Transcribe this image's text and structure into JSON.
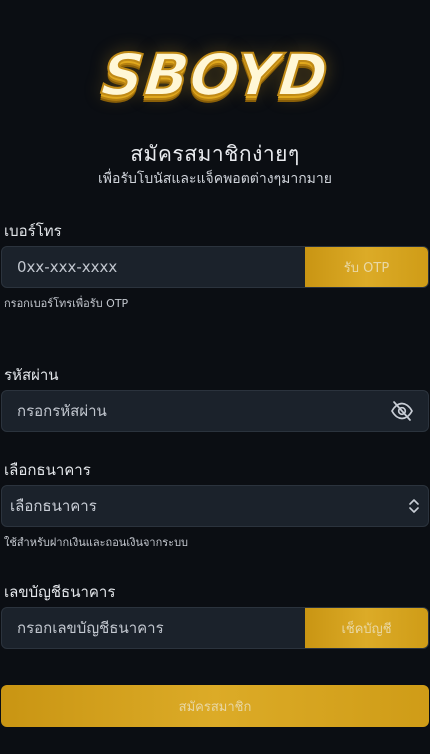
{
  "brand": {
    "logo_text": "SBOYD"
  },
  "header": {
    "title": "สมัครสมาชิกง่ายๆ",
    "subtitle": "เพื่อรับโบนัสและแจ็คพอตต่างๆมากมาย"
  },
  "phone": {
    "label": "เบอร์โทร",
    "placeholder": "0xx-xxx-xxxx",
    "otp_button": "รับ OTP",
    "hint": "กรอกเบอร์โทรเพื่อรับ OTP"
  },
  "password": {
    "label": "รหัสผ่าน",
    "placeholder": "กรอกรหัสผ่าน",
    "toggle_icon": "eye-off-icon"
  },
  "bank": {
    "label": "เลือกธนาคาร",
    "selected": "เลือกธนาคาร",
    "hint": "ใช้สำหรับฝากเงินและถอนเงินจากระบบ"
  },
  "account": {
    "label": "เลขบัญชีธนาคาร",
    "placeholder": "กรอกเลขบัญชีธนาคาร",
    "check_button": "เช็คบัญชี"
  },
  "submit": {
    "label": "สมัครสมาชิก"
  },
  "colors": {
    "background": "#0b0e13",
    "field": "#1b222b",
    "accent_gold": "#d4a21f"
  }
}
